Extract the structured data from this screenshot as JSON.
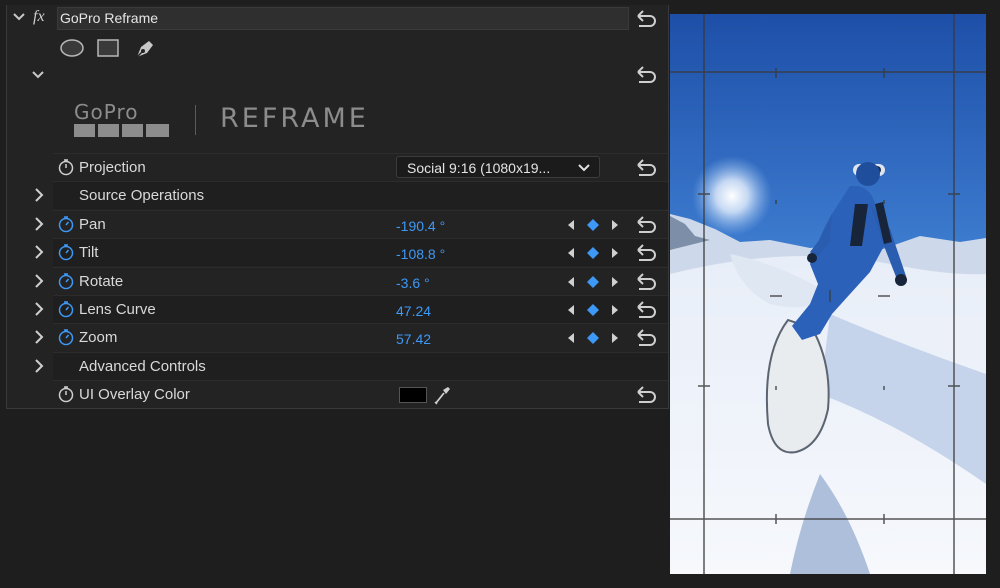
{
  "effect": {
    "title": "GoPro Reframe",
    "fx_symbol": "fx"
  },
  "logo": {
    "brand": "GoPro",
    "product": "REFRAME"
  },
  "params": [
    {
      "label": "Projection",
      "type": "dropdown",
      "value": "Social 9:16  (1080x19..."
    },
    {
      "label": "Source Operations",
      "type": "group"
    },
    {
      "label": "Pan",
      "type": "value",
      "value": "-190.4 °"
    },
    {
      "label": "Tilt",
      "type": "value",
      "value": "-108.8 °"
    },
    {
      "label": "Rotate",
      "type": "value",
      "value": "-3.6 °"
    },
    {
      "label": "Lens Curve",
      "type": "value",
      "value": "47.24"
    },
    {
      "label": "Zoom",
      "type": "value",
      "value": "57.42"
    },
    {
      "label": "Advanced Controls",
      "type": "group"
    },
    {
      "label": "UI Overlay Color",
      "type": "color",
      "value": "#000000"
    }
  ],
  "colors": {
    "accent": "#3e98f5",
    "panel": "#232323",
    "background": "#1e1e1e"
  }
}
